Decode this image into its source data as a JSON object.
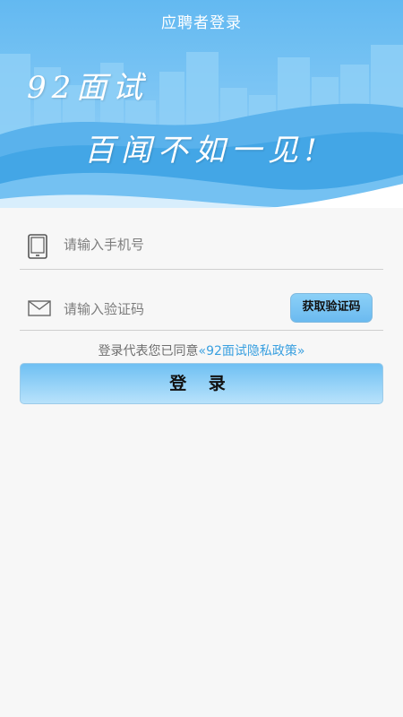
{
  "header": {
    "title": "应聘者登录"
  },
  "banner": {
    "slogan_line1": "92面试",
    "slogan_line2": "百闻不如一见!"
  },
  "form": {
    "phone_placeholder": "请输入手机号",
    "code_placeholder": "请输入验证码",
    "get_code_label": "获取验证码"
  },
  "agreement": {
    "prefix": "登录代表您已同意",
    "policy_link": "«92面试隐私政策»"
  },
  "login_button": {
    "label": "登 录"
  },
  "colors": {
    "header_blue": "#63b9f1",
    "link_blue": "#3aa0e0",
    "background": "#f7f7f7"
  },
  "icons": {
    "phone": "tablet-phone-icon",
    "code": "envelope-icon"
  }
}
